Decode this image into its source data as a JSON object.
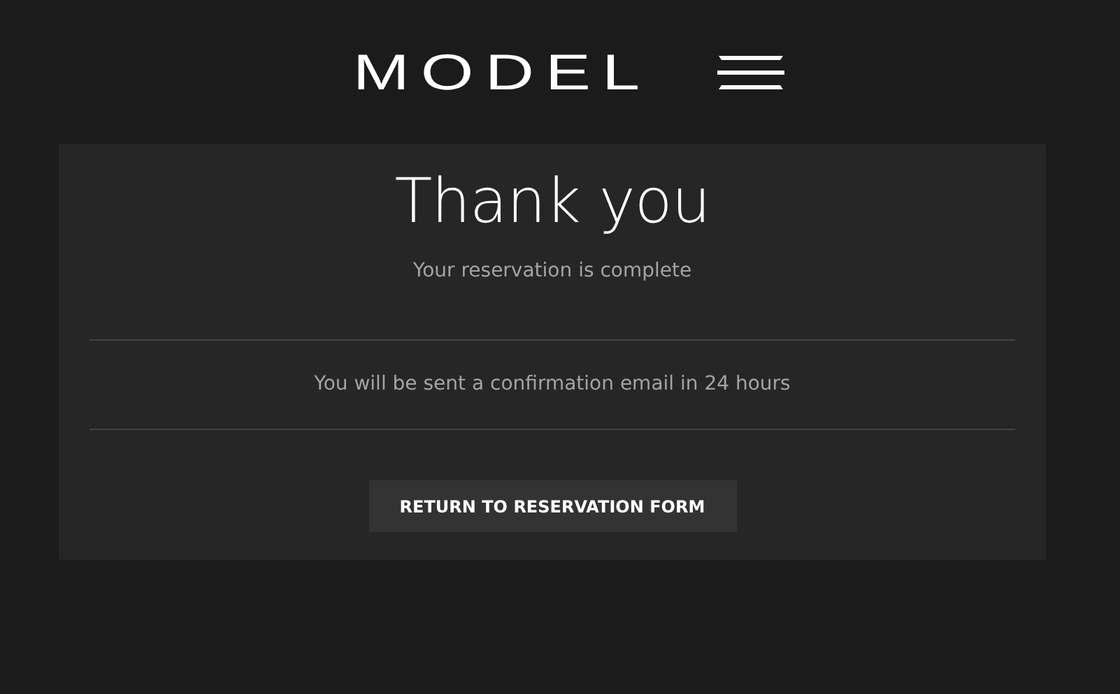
{
  "header": {
    "logo_text": "MODEL"
  },
  "card": {
    "title": "Thank you",
    "subtitle": "Your reservation is complete",
    "message": "You will be sent a confirmation email in 24 hours",
    "button": "RETURN TO RESERVATION FORM"
  }
}
